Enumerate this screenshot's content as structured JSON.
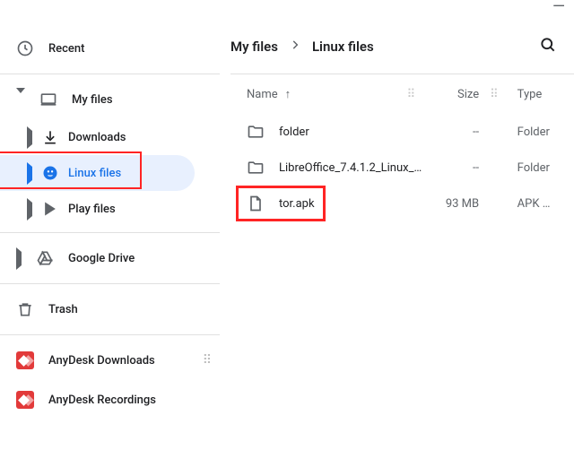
{
  "window": {
    "minimize": "—"
  },
  "sidebar": {
    "recent": "Recent",
    "myfiles": "My files",
    "downloads": "Downloads",
    "linux": "Linux files",
    "play": "Play files",
    "gdrive": "Google Drive",
    "trash": "Trash",
    "anydesk_dl": "AnyDesk Downloads",
    "anydesk_rec": "AnyDesk Recordings"
  },
  "breadcrumb": {
    "root": "My files",
    "current": "Linux files"
  },
  "columns": {
    "name": "Name",
    "size": "Size",
    "type": "Type"
  },
  "files": [
    {
      "name": "folder",
      "size": "--",
      "type": "Folder",
      "kind": "folder"
    },
    {
      "name": "LibreOffice_7.4.1.2_Linux_…",
      "size": "--",
      "type": "Folder",
      "kind": "folder"
    },
    {
      "name": "tor.apk",
      "size": "93 MB",
      "type": "APK …",
      "kind": "file"
    }
  ]
}
